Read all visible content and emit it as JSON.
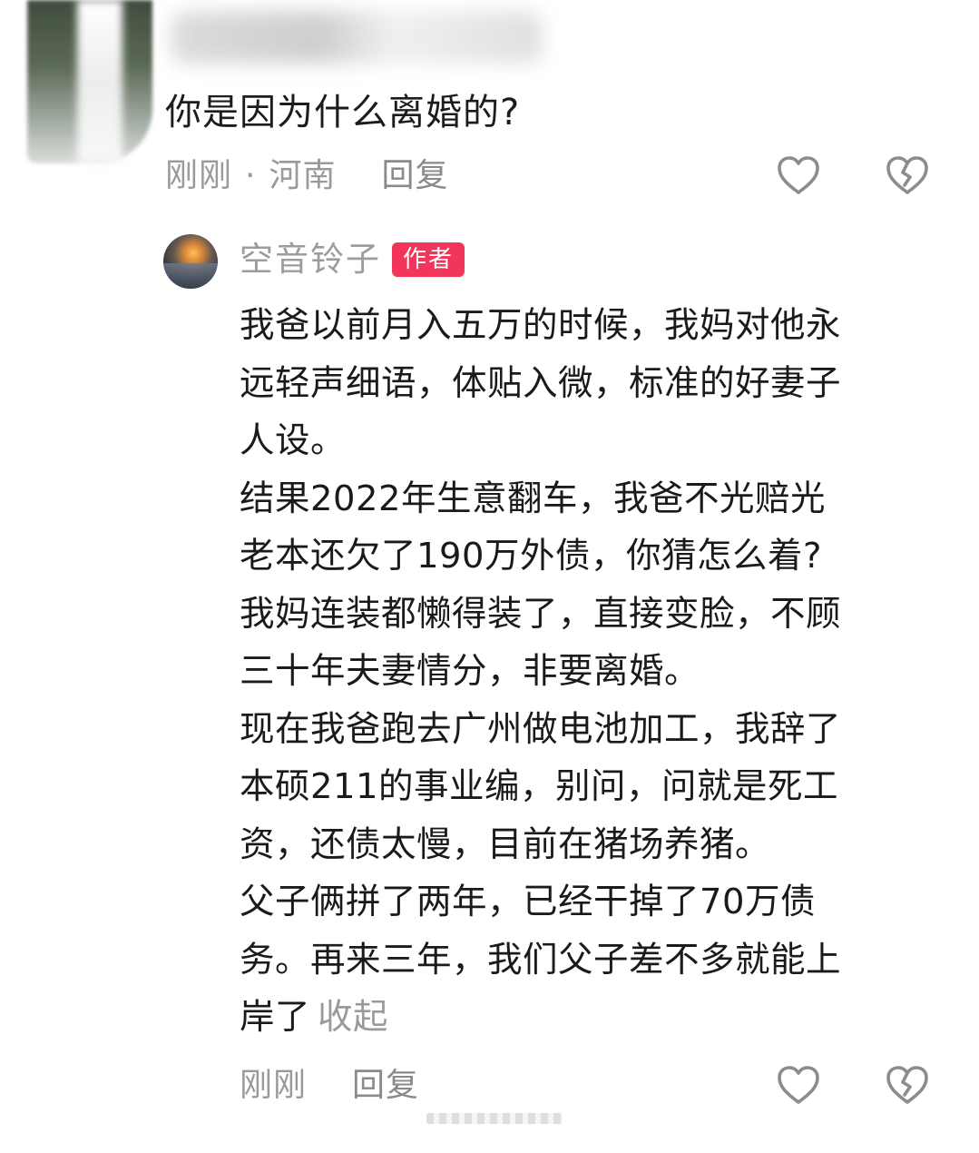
{
  "comment": {
    "text": "你是因为什么离婚的?",
    "time": "刚刚",
    "separator": "·",
    "location": "河南",
    "reply_label": "回复",
    "like_icon": "heart-outline-icon",
    "dislike_icon": "broken-heart-icon"
  },
  "reply": {
    "author_name": "空音铃子",
    "author_badge": "作者",
    "lines": [
      "我爸以前月入五万的时候，我妈对他永",
      "远轻声细语，体贴入微，标准的好妻子",
      "人设。",
      "结果2022年生意翻车，我爸不光赔光",
      "老本还欠了190万外债，你猜怎么着?",
      "我妈连装都懒得装了，直接变脸，不顾",
      "三十年夫妻情分，非要离婚。",
      "现在我爸跑去广州做电池加工，我辞了",
      "本硕211的事业编，别问，问就是死工",
      "资，还债太慢，目前在猪场养猪。",
      "父子俩拼了两年，已经干掉了70万债",
      "务。再来三年，我们父子差不多就能上",
      "岸了"
    ],
    "collapse_label": "收起",
    "time": "刚刚",
    "reply_label": "回复",
    "like_icon": "heart-outline-icon",
    "dislike_icon": "broken-heart-icon"
  }
}
